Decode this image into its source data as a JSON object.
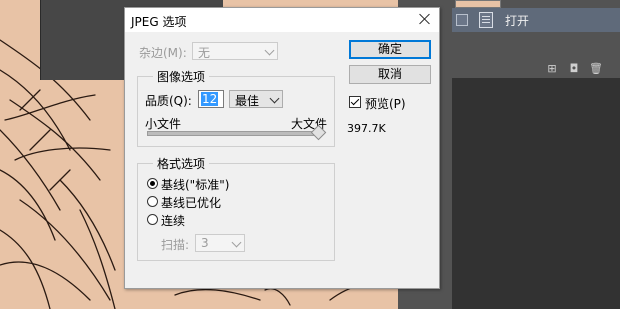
{
  "photoshop": {
    "layer_open_label": "打开"
  },
  "dialog": {
    "title": "JPEG 选项",
    "matte_label": "杂边(M):",
    "matte_value": "无",
    "ok_label": "确定",
    "cancel_label": "取消",
    "preview_label": "预览(P)",
    "preview_checked": true,
    "file_size": "397.7K",
    "image_options": {
      "legend": "图像选项",
      "quality_label": "品质(Q):",
      "quality_value": "12",
      "quality_preset": "最佳",
      "slider_min_label": "小文件",
      "slider_max_label": "大文件",
      "slider_fraction": 1.0
    },
    "format_options": {
      "legend": "格式选项",
      "options": [
        {
          "label": "基线(\"标准\")",
          "selected": true
        },
        {
          "label": "基线已优化",
          "selected": false
        },
        {
          "label": "连续",
          "selected": false
        }
      ],
      "scans_label": "扫描:",
      "scans_value": "3"
    }
  }
}
